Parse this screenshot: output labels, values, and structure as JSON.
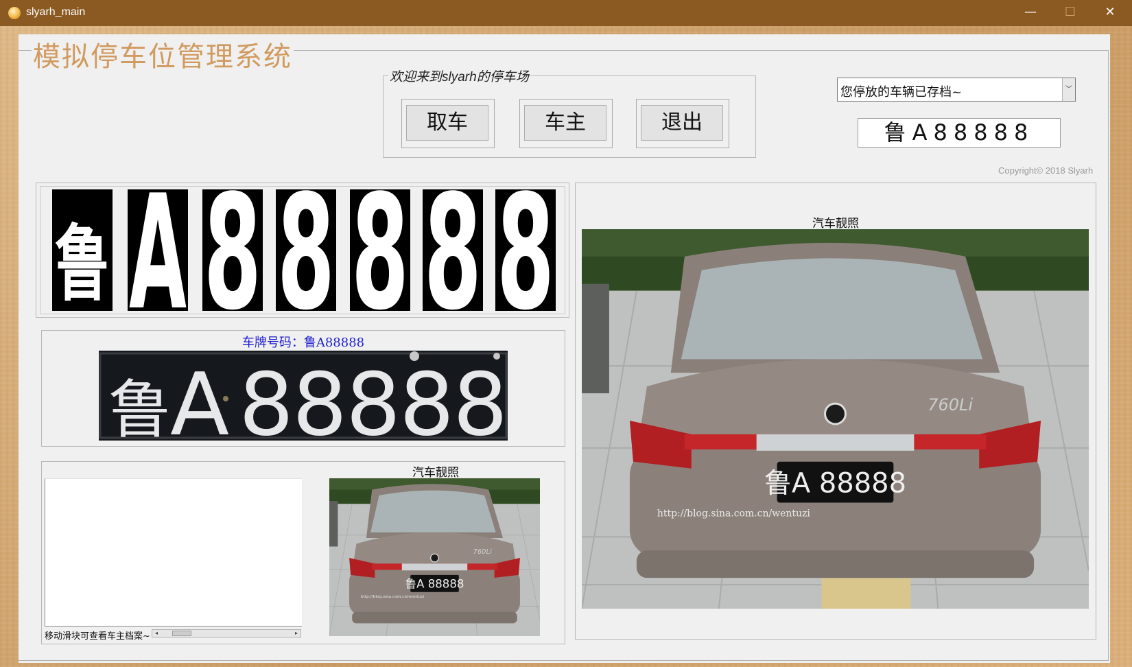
{
  "window": {
    "title": "slyarh_main",
    "controls": {
      "minimize": "—",
      "maximize": "☐",
      "close": "✕"
    }
  },
  "main": {
    "heading": "模拟停车位管理系统",
    "welcome": {
      "prefix": "欢迎来到",
      "brand": "slyarh",
      "suffix": "的停车场"
    },
    "buttons": {
      "pickup": "取车",
      "owner": "车主",
      "exit": "退出"
    },
    "archive_select": {
      "selected": "您停放的车辆已存档~"
    },
    "plate_display": "鲁A88888",
    "copyright": "Copyright© 2018 Slyarh"
  },
  "segmented_chars": [
    "鲁",
    "A",
    "8",
    "8",
    "8",
    "8",
    "8"
  ],
  "plate_panel": {
    "caption": "车牌号码：鲁A88888",
    "plate_text": "鲁A88888"
  },
  "owner_panel": {
    "slider_label": "移动滑块可查看车主档案~",
    "slider_position": 0.1
  },
  "photo_small": {
    "caption": "汽车靓照",
    "plate_text": "鲁A 88888",
    "badge": "760Li",
    "watermark": "http://blog.sina.com.cn/wentuzi"
  },
  "photo_big": {
    "caption": "汽车靓照",
    "plate_text": "鲁A 88888",
    "badge": "760Li",
    "watermark": "http://blog.sina.com.cn/wentuzi"
  },
  "colors": {
    "titlebar": "#8b5a22",
    "heading": "#d19a5f",
    "plate_caption": "#1f1fcf",
    "car_body": "#8a8079"
  }
}
